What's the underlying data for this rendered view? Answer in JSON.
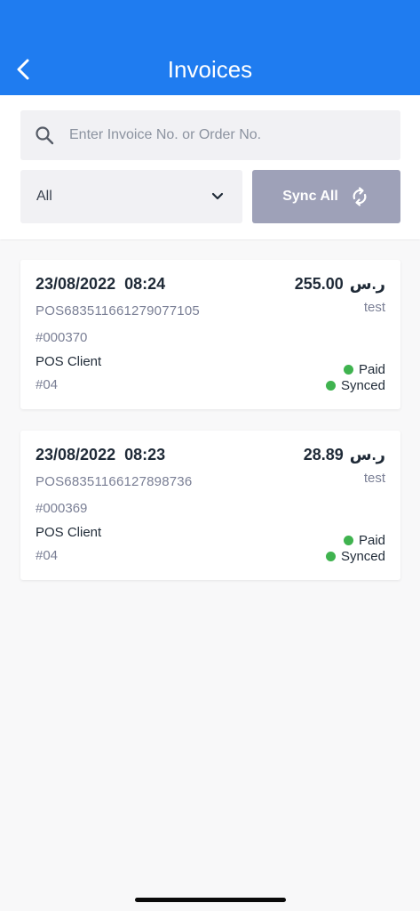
{
  "header": {
    "title": "Invoices"
  },
  "filters": {
    "search_placeholder": "Enter Invoice No. or Order No.",
    "status_selected": "All",
    "sync_label": "Sync All"
  },
  "invoices": [
    {
      "datetime": "23/08/2022  08:24",
      "amount": "255.00",
      "currency": "ر.س",
      "pos_number": "POS683511661279077105",
      "note": "test",
      "invoice_no": "#000370",
      "client": "POS Client",
      "table": "#04",
      "payment_status": "Paid",
      "sync_status": "Synced"
    },
    {
      "datetime": "23/08/2022  08:23",
      "amount": "28.89",
      "currency": "ر.س",
      "pos_number": "POS68351166127898736",
      "note": "test",
      "invoice_no": "#000369",
      "client": "POS Client",
      "table": "#04",
      "payment_status": "Paid",
      "sync_status": "Synced"
    }
  ],
  "colors": {
    "header_bg": "#1f7cf0",
    "sync_button_bg": "#9ea1b8",
    "status_dot": "#3fb34f"
  }
}
